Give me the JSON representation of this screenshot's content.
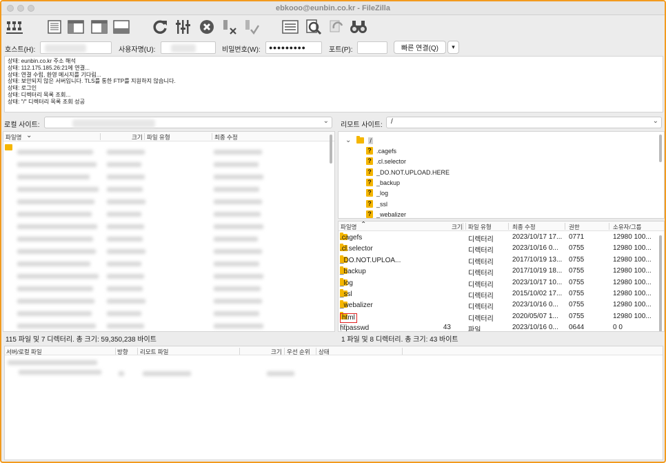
{
  "window": {
    "title": "ebkooo@eunbin.co.kr - FileZilla",
    "border_color": "#f29a1e"
  },
  "toolbar": {
    "buttons": [
      {
        "icon": "site-manager-icon"
      },
      {
        "icon": "toggle-message-log-icon"
      },
      {
        "icon": "toggle-local-tree-icon"
      },
      {
        "icon": "toggle-remote-tree-icon"
      },
      {
        "icon": "toggle-queue-icon"
      },
      {
        "icon": "refresh-icon"
      },
      {
        "icon": "process-queue-icon"
      },
      {
        "icon": "cancel-icon"
      },
      {
        "icon": "disconnect-icon"
      },
      {
        "icon": "reconnect-icon"
      },
      {
        "icon": "directory-listing-filter-icon"
      },
      {
        "icon": "toggle-comparison-icon"
      },
      {
        "icon": "sync-browsing-icon"
      },
      {
        "icon": "search-remote-files-icon"
      }
    ]
  },
  "quickconnect": {
    "host_label": "호스트(H):",
    "user_label": "사용자명(U):",
    "password_label": "비밀번호(W):",
    "password_value": "●●●●●●●●●",
    "port_label": "포트(P):",
    "connect_label": "빠른 연결(Q)",
    "dropdown": "▾"
  },
  "log": [
    "상태:  eunbin.co.kr 주소 해석",
    "상태:  112.175.185.26:21에 연결...",
    "상태:  연결 수립, 환영 메시지를 기다림...",
    "상태:  보안되지 않은 서버입니다. TLS를 통한 FTP를 지원하지 않습니다.",
    "상태:  로그인",
    "상태:  디렉터리 목록 조회...",
    "상태:  \"/\" 디렉터리 목록 조회 성공"
  ],
  "local": {
    "site_label": "로컬 사이트:",
    "columns": {
      "name": "파일명",
      "size": "크기",
      "type": "파일 유형",
      "modified": "최종 수정"
    },
    "status": "115 파일 및 7 디렉터리. 총 크기: 59,350,238 바이트"
  },
  "remote": {
    "site_label": "리모트 사이트:",
    "path": "/",
    "tree_root": "/",
    "tree": [
      ".cagefs",
      ".cl.selector",
      "_DO.NOT.UPLOAD.HERE",
      "_backup",
      "_log",
      "_ssl",
      "_webalizer"
    ],
    "columns": {
      "name": "파일명",
      "size": "크기",
      "type": "파일 유형",
      "modified": "최종 수정",
      "perms": "권한",
      "owner": "소유자/그룹"
    },
    "files": [
      {
        "name": ".cagefs",
        "size": "",
        "type": "디렉터리",
        "modified": "2023/10/17 17...",
        "perms": "0771",
        "owner": "12980 100...",
        "kind": "folder"
      },
      {
        "name": ".cl.selector",
        "size": "",
        "type": "디렉터리",
        "modified": "2023/10/16 0...",
        "perms": "0755",
        "owner": "12980 100...",
        "kind": "folder"
      },
      {
        "name": "_DO.NOT.UPLOA...",
        "size": "",
        "type": "디렉터리",
        "modified": "2017/10/19 13...",
        "perms": "0755",
        "owner": "12980 100...",
        "kind": "folder"
      },
      {
        "name": "_backup",
        "size": "",
        "type": "디렉터리",
        "modified": "2017/10/19 18...",
        "perms": "0755",
        "owner": "12980 100...",
        "kind": "folder"
      },
      {
        "name": "_log",
        "size": "",
        "type": "디렉터리",
        "modified": "2023/10/17 10...",
        "perms": "0755",
        "owner": "12980 100...",
        "kind": "folder"
      },
      {
        "name": "_ssl",
        "size": "",
        "type": "디렉터리",
        "modified": "2015/10/02 17...",
        "perms": "0755",
        "owner": "12980 100...",
        "kind": "folder"
      },
      {
        "name": "_webalizer",
        "size": "",
        "type": "디렉터리",
        "modified": "2023/10/16 0...",
        "perms": "0755",
        "owner": "12980 100...",
        "kind": "folder"
      },
      {
        "name": "html",
        "size": "",
        "type": "디렉터리",
        "modified": "2020/05/07 1...",
        "perms": "0755",
        "owner": "12980 100...",
        "kind": "folder",
        "highlight": true
      },
      {
        "name": "htpasswd",
        "size": "43",
        "type": "파일",
        "modified": "2023/10/16 0...",
        "perms": "0644",
        "owner": "0 0",
        "kind": "file"
      }
    ],
    "status": "1 파일 및 8 디렉터리. 총 크기: 43 바이트"
  },
  "queue": {
    "columns": {
      "server": "서버/로컬 파일",
      "direction": "방향",
      "remote": "리모트 파일",
      "size": "크기",
      "priority": "우선 순위",
      "status": "상태"
    }
  },
  "colors": {
    "folder": "#f5b600",
    "highlight": "#e02020",
    "accent": "#f29a1e"
  }
}
